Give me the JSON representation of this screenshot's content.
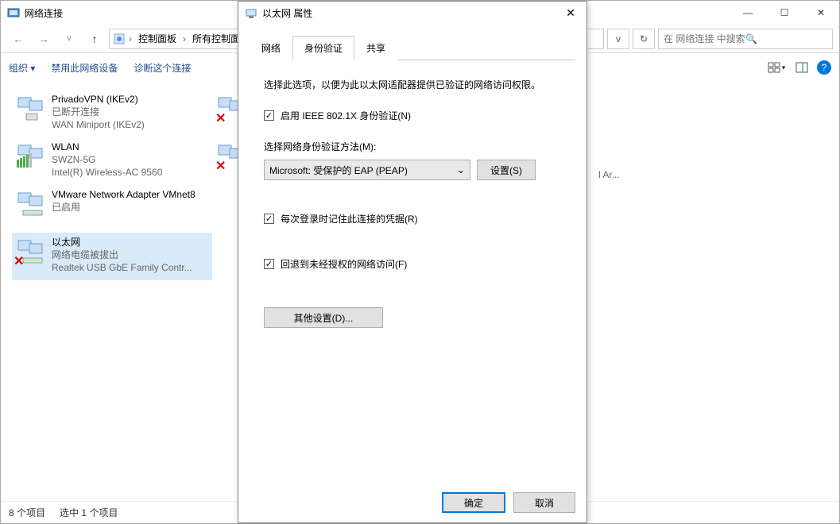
{
  "window": {
    "title": "网络连接",
    "controls": {
      "min": "—",
      "max": "☐",
      "close": "✕"
    }
  },
  "addressbar": {
    "root_icon": "control-panel-icon",
    "segments": [
      "控制面板",
      "所有控制面板"
    ],
    "chevron": "›",
    "dropdown": "v",
    "refresh_icon": "↻"
  },
  "search": {
    "placeholder": "在 网络连接 中搜索",
    "icon": "🔍"
  },
  "cmdbar": {
    "organize": "组织 ▾",
    "disable": "禁用此网络设备",
    "diagnose": "诊断这个连接"
  },
  "adapters": [
    {
      "name": "PrivadoVPN (IKEv2)",
      "status": "已断开连接",
      "device": "WAN Miniport (IKEv2)",
      "red_x": true
    },
    {
      "name": "WLAN",
      "status": "SWZN-5G",
      "device": "Intel(R) Wireless-AC 9560",
      "red_x": false,
      "bars": true
    },
    {
      "name": "",
      "status": "",
      "device": "",
      "red_x": true,
      "partial": true
    },
    {
      "name": "",
      "status": "",
      "device": "",
      "red_x": true,
      "partial": true
    },
    {
      "name": "",
      "status": "l Ar...",
      "device": "",
      "partial_right": true
    },
    {
      "name": "VMware Network Adapter VMnet8",
      "status": "已启用",
      "device": "",
      "red_x": false
    },
    {
      "name": "以太网",
      "status": "网络电缆被拔出",
      "device": "Realtek USB GbE Family Contr...",
      "red_x": true,
      "selected": true
    }
  ],
  "statusbar": {
    "left": "8 个项目",
    "right": "选中 1 个项目"
  },
  "dialog": {
    "title": "以太网 属性",
    "tabs": [
      "网络",
      "身份验证",
      "共享"
    ],
    "active_tab": 1,
    "auth": {
      "intro": "选择此选项，以便为此以太网适配器提供已验证的网络访问权限。",
      "enable_8021x": "启用 IEEE 802.1X 身份验证(N)",
      "method_label": "选择网络身份验证方法(M):",
      "method_value": "Microsoft: 受保护的 EAP (PEAP)",
      "settings_btn": "设置(S)",
      "remember": "每次登录时记住此连接的凭据(R)",
      "fallback": "回退到未经授权的网络访问(F)",
      "other_settings": "其他设置(D)..."
    },
    "footer": {
      "ok": "确定",
      "cancel": "取消"
    }
  }
}
